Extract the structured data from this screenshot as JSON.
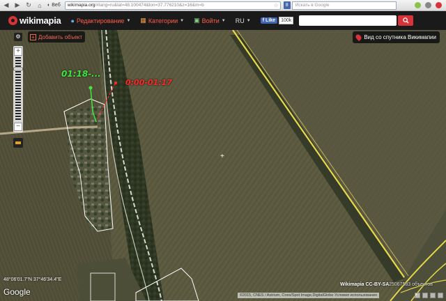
{
  "browser": {
    "page_label": "Веб",
    "url_host": "wikimapia.org",
    "url_rest": "/#lang=ru&lat=48.100474&lon=37.776210&z=16&m=b",
    "search_placeholder": "Искать в Google",
    "search_engine": "8"
  },
  "header": {
    "logo": "wikimapia",
    "menu": [
      {
        "label": "Редактирование",
        "icon": "globe-icon"
      },
      {
        "label": "Категории",
        "icon": "categories-icon"
      },
      {
        "label": "Войти",
        "icon": "login-icon"
      },
      {
        "label": "RU",
        "icon": ""
      }
    ],
    "fb_like": "Like",
    "fb_count": "100k"
  },
  "map": {
    "add_object": "Добавить объект",
    "satellite_view": "Вид со спутника Викимапии",
    "label_green": "01:18-...",
    "label_red": "0:00-01:17",
    "coords": "48°06'01.7\"N 37°46'34.4\"E",
    "google": "Google",
    "copyright": "©2015, CNES / Astrium, Cnes/Spot Image,DigitalGlobe  Условия использования",
    "wikimapia_cc": "Wikimapia CC-BY-SA",
    "object_count": "25067583 объектов"
  },
  "colors": {
    "accent": "#d8323a",
    "green_track": "#3ee83e",
    "red_track": "#ff2a2a"
  }
}
